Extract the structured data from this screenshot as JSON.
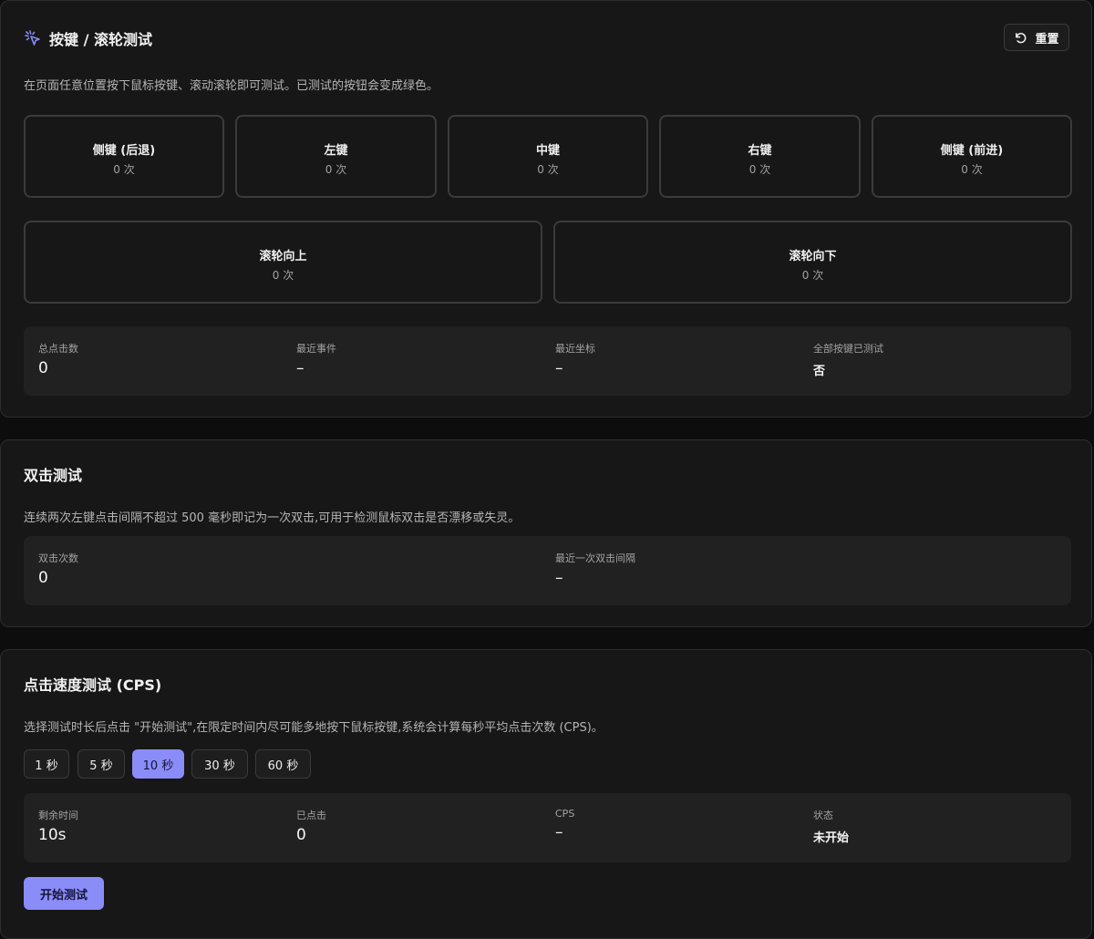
{
  "buttons_card": {
    "title": "按键 / 滚轮测试",
    "reset_label": "重置",
    "description": "在页面任意位置按下鼠标按键、滚动滚轮即可测试。已测试的按钮会变成绿色。",
    "buttons": [
      {
        "name": "侧键 (后退)",
        "count": "0 次"
      },
      {
        "name": "左键",
        "count": "0 次"
      },
      {
        "name": "中键",
        "count": "0 次"
      },
      {
        "name": "右键",
        "count": "0 次"
      },
      {
        "name": "侧键 (前进)",
        "count": "0 次"
      }
    ],
    "wheel": [
      {
        "name": "滚轮向上",
        "count": "0 次"
      },
      {
        "name": "滚轮向下",
        "count": "0 次"
      }
    ],
    "stats": [
      {
        "label": "总点击数",
        "value": "0"
      },
      {
        "label": "最近事件",
        "value": "–"
      },
      {
        "label": "最近坐标",
        "value": "–"
      },
      {
        "label": "全部按键已测试",
        "value": "否"
      }
    ]
  },
  "double_click_card": {
    "title": "双击测试",
    "description": "连续两次左键点击间隔不超过 500 毫秒即记为一次双击,可用于检测鼠标双击是否漂移或失灵。",
    "stats": [
      {
        "label": "双击次数",
        "value": "0"
      },
      {
        "label": "最近一次双击间隔",
        "value": "–"
      }
    ]
  },
  "cps_card": {
    "title": "点击速度测试 (CPS)",
    "description": "选择测试时长后点击 \"开始测试\",在限定时间内尽可能多地按下鼠标按键,系统会计算每秒平均点击次数 (CPS)。",
    "durations": [
      "1 秒",
      "5 秒",
      "10 秒",
      "30 秒",
      "60 秒"
    ],
    "selected_duration": "10 秒",
    "stats": [
      {
        "label": "剩余时间",
        "value": "10s"
      },
      {
        "label": "已点击",
        "value": "0"
      },
      {
        "label": "CPS",
        "value": "–"
      },
      {
        "label": "状态",
        "value": "未开始"
      }
    ],
    "start_label": "开始测试"
  },
  "colors": {
    "accent": "#8a8cf7",
    "card_bg": "#171717",
    "page_bg": "#0d0d0d",
    "panel_bg": "#212121"
  }
}
